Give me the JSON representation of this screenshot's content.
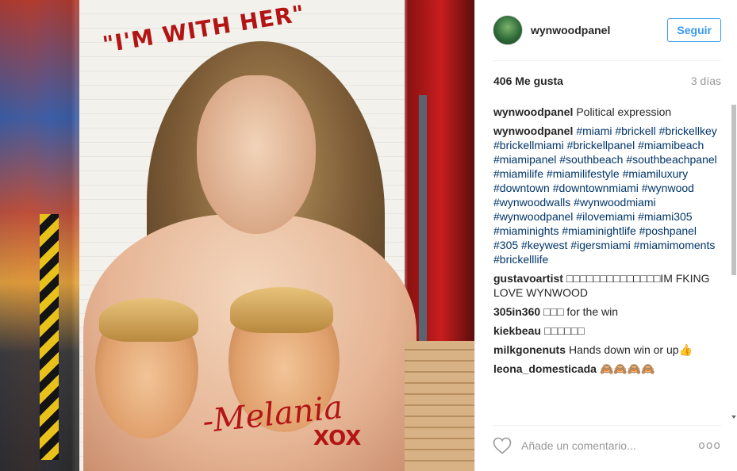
{
  "post": {
    "painted_caption": "\"I'M WITH HER\"",
    "painted_signature": "-Melania",
    "painted_xo": "XOX",
    "image_alt_icon": "mural-photo"
  },
  "header": {
    "username": "wynwoodpanel",
    "follow_label": "Seguir"
  },
  "meta": {
    "likes": "406 Me gusta",
    "time": "3 días"
  },
  "comments": [
    {
      "author": "wynwoodpanel",
      "text": "Political expression"
    },
    {
      "author": "wynwoodpanel",
      "text": "#miami #brickell #brickellkey #brickellmiami #brickellpanel #miamibeach #miamipanel #southbeach #southbeachpanel #miamilife #miamilifestyle #miamiluxury #downtown #downtownmiami #wynwood #wynwoodwalls #wynwoodmiami #wynwoodpanel #ilovemiami #miami305 #miaminights #miaminightlife #poshpanel #305 #keywest #igersmiami #miamimoments #brickelllife"
    },
    {
      "author": "gustavoartist",
      "text": "□□□□□□□□□□□□□□IM FKING LOVE WYNWOOD"
    },
    {
      "author": "305in360",
      "text": "□□□ for the win"
    },
    {
      "author": "kiekbeau",
      "text": "□□□□□□"
    },
    {
      "author": "milkgonenuts",
      "text": "Hands down win or up👍"
    },
    {
      "author": "leona_domesticada",
      "text": "🙈🙈🙈🙈"
    }
  ],
  "footer": {
    "comment_placeholder": "Añade un comentario...",
    "more_label": "ooo"
  },
  "colors": {
    "accent": "#3897f0",
    "hashtag": "#003569",
    "muted": "#999999"
  }
}
